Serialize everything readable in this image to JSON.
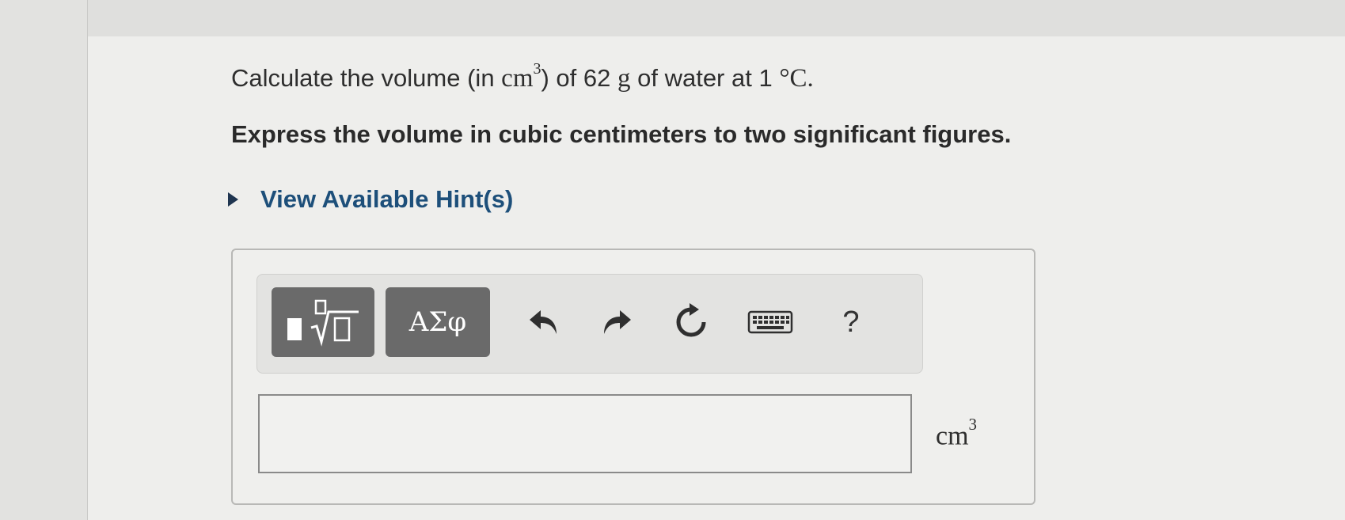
{
  "question": {
    "prefix": "Calculate the volume (in ",
    "unit_base": "cm",
    "unit_exp": "3",
    "middle": ") of 62 ",
    "mass_unit": "g",
    "suffix": " of water at 1 ",
    "temp_unit": "°C",
    "end": "."
  },
  "instruction": "Express the volume in cubic centimeters to two significant figures.",
  "hint": {
    "label": "View Available Hint(s)",
    "icon": "triangle-right-icon"
  },
  "toolbar": {
    "templates_icon": "math-templates-icon",
    "symbols_label": "ΑΣφ",
    "undo_icon": "undo-icon",
    "redo_icon": "redo-icon",
    "reset_icon": "reset-icon",
    "keyboard_icon": "keyboard-icon",
    "help_label": "?"
  },
  "answer": {
    "value": "",
    "unit_base": "cm",
    "unit_exp": "3"
  },
  "colors": {
    "background": "#eeeeec",
    "hint_text": "#1d4f7a",
    "toolbar_button": "#6a6a6a",
    "input_border": "#8a8a8a"
  }
}
